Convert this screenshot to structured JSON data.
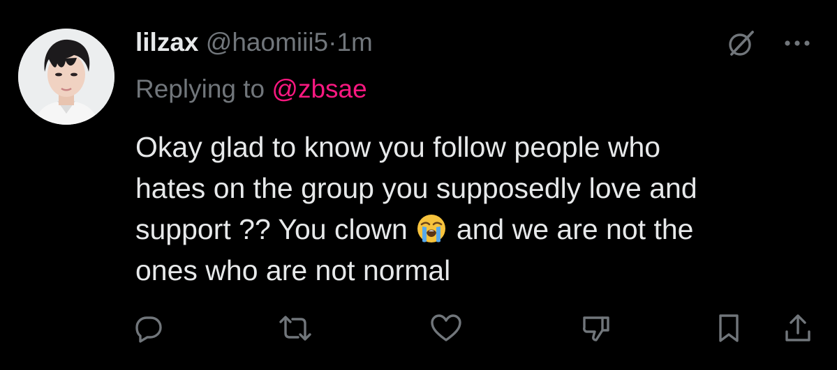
{
  "tweet": {
    "author_name": "lilzax",
    "handle": "@haomiii5",
    "separator": "·",
    "time": "1m",
    "replying_prefix": "Replying to",
    "replying_to": "@zbsae",
    "text_line1": "Okay glad to know you follow people who",
    "text_line2": "hates on the group you supposedly love and",
    "text_line3_before": "support ?? You clown",
    "text_line3_after": "and we are not the",
    "text_line4": "ones who are not normal",
    "emoji": "loudly-crying-face"
  },
  "icons": {
    "header": [
      "grok-icon",
      "more-icon"
    ],
    "actions": [
      "reply-icon",
      "retweet-icon",
      "like-icon",
      "downvote-icon",
      "bookmark-icon",
      "share-icon"
    ]
  },
  "colors": {
    "background": "#000000",
    "text": "#e7e9ea",
    "secondary": "#71767b",
    "mention": "#f91880"
  }
}
